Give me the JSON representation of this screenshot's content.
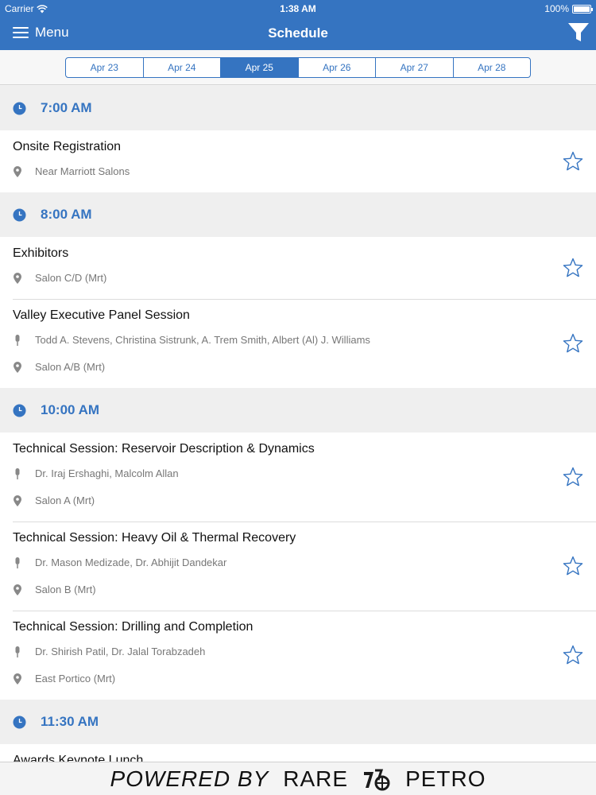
{
  "status_bar": {
    "carrier": "Carrier",
    "time": "1:38 AM",
    "battery": "100%"
  },
  "nav": {
    "menu_label": "Menu",
    "title": "Schedule"
  },
  "dates": [
    {
      "label": "Apr 23",
      "active": false
    },
    {
      "label": "Apr 24",
      "active": false
    },
    {
      "label": "Apr 25",
      "active": true
    },
    {
      "label": "Apr 26",
      "active": false
    },
    {
      "label": "Apr 27",
      "active": false
    },
    {
      "label": "Apr 28",
      "active": false
    }
  ],
  "schedule": [
    {
      "time": "7:00 AM",
      "sessions": [
        {
          "title": "Onsite Registration",
          "speakers": "",
          "location": "Near Marriott Salons"
        }
      ]
    },
    {
      "time": "8:00 AM",
      "sessions": [
        {
          "title": "Exhibitors",
          "speakers": "",
          "location": "Salon C/D (Mrt)"
        },
        {
          "title": "Valley Executive Panel Session",
          "speakers": "Todd A. Stevens, Christina Sistrunk, A. Trem Smith, Albert (Al) J. Williams",
          "location": "Salon A/B (Mrt)"
        }
      ]
    },
    {
      "time": "10:00 AM",
      "sessions": [
        {
          "title": "Technical Session: Reservoir Description & Dynamics",
          "speakers": "Dr. Iraj Ershaghi, Malcolm Allan",
          "location": "Salon A (Mrt)"
        },
        {
          "title": "Technical Session: Heavy Oil & Thermal Recovery",
          "speakers": "Dr. Mason Medizade, Dr. Abhijit Dandekar",
          "location": "Salon B (Mrt)"
        },
        {
          "title": "Technical Session: Drilling and Completion",
          "speakers": "Dr. Shirish Patil, Dr. Jalal Torabzadeh",
          "location": "East Portico (Mrt)"
        }
      ]
    },
    {
      "time": "11:30 AM",
      "sessions": [
        {
          "title": "Awards Keynote Lunch",
          "speakers": "",
          "location": ""
        }
      ]
    }
  ],
  "footer": {
    "powered_by": "POWERED BY",
    "brand_left": "RARE",
    "brand_right": "PETRO"
  },
  "icons": {
    "clock": "clock-icon",
    "pin": "location-pin-icon",
    "mic": "microphone-icon",
    "star": "star-outline-icon",
    "filter": "filter-icon",
    "menu": "hamburger-menu-icon"
  },
  "colors": {
    "brand": "#3574c1",
    "section_bg": "#efefef",
    "meta_text": "#777777"
  }
}
